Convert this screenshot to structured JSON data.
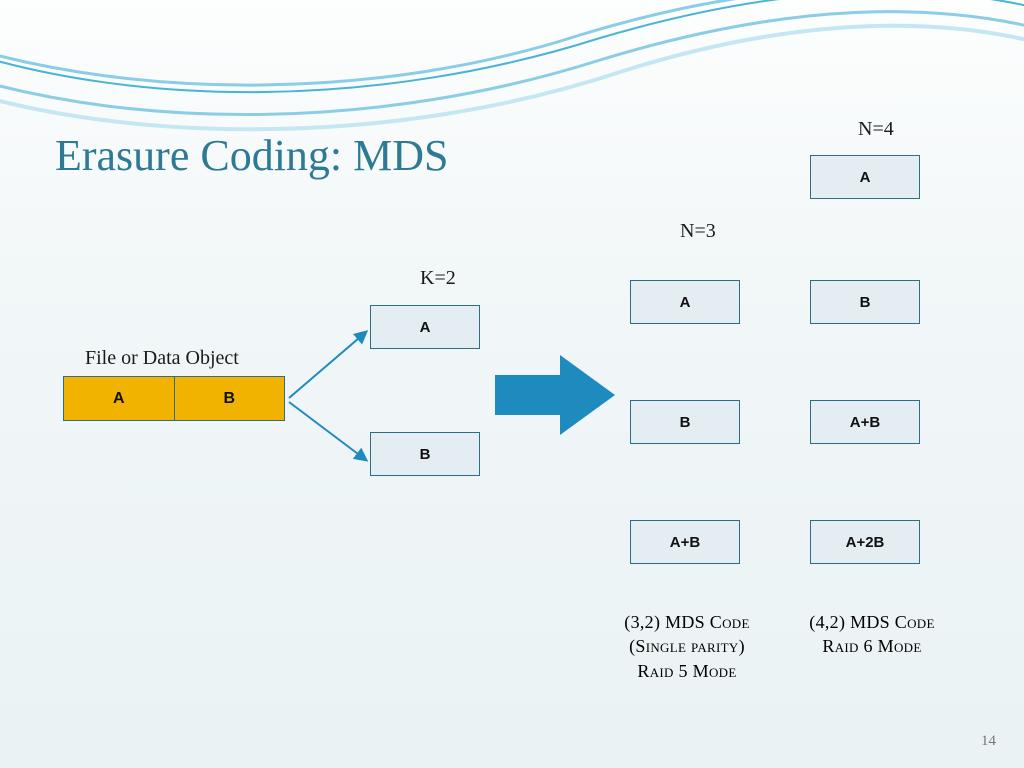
{
  "title": "Erasure Coding: MDS",
  "file_label": "File or Data Object",
  "file_cells": {
    "a": "A",
    "b": "B"
  },
  "k": {
    "label": "K=2",
    "boxes": {
      "a": "A",
      "b": "B"
    }
  },
  "n3": {
    "label": "N=3",
    "boxes": {
      "a": "A",
      "b": "B",
      "ab": "A+B"
    },
    "caption_line1": "(3,2) MDS Code",
    "caption_line2": "(Single parity)",
    "caption_line3": "Raid 5 Mode"
  },
  "n4": {
    "label": "N=4",
    "boxes": {
      "a": "A",
      "b": "B",
      "ab": "A+B",
      "a2b": "A+2B"
    },
    "caption_line1": "(4,2) MDS Code",
    "caption_line2": "Raid 6 Mode"
  },
  "page_number": "14"
}
